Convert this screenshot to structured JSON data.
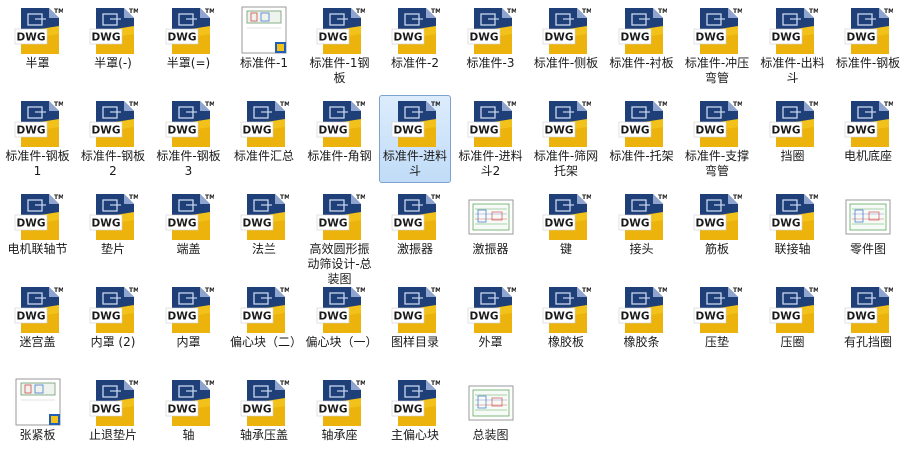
{
  "colors": {
    "selection": "#c9e0f7",
    "selection_border": "#7da2ce",
    "dwg_yellow": "#f1c40f",
    "dwg_blue": "#1f3f79"
  },
  "icons": {
    "dwg": "dwg-file-icon",
    "thumb_red": "drawing-thumbnail-icon",
    "thumb_green": "drawing-preview-icon"
  },
  "files": [
    {
      "label": "半罩",
      "icon": "dwg"
    },
    {
      "label": "半罩(-)",
      "icon": "dwg"
    },
    {
      "label": "半罩(=)",
      "icon": "dwg"
    },
    {
      "label": "标准件-1",
      "icon": "thumb_red"
    },
    {
      "label": "标准件-1钢板",
      "icon": "dwg"
    },
    {
      "label": "标准件-2",
      "icon": "dwg"
    },
    {
      "label": "标准件-3",
      "icon": "dwg"
    },
    {
      "label": "标准件-侧板",
      "icon": "dwg"
    },
    {
      "label": "标准件-衬板",
      "icon": "dwg"
    },
    {
      "label": "标准件-冲压弯管",
      "icon": "dwg"
    },
    {
      "label": "标准件-出料斗",
      "icon": "dwg"
    },
    {
      "label": "标准件-钢板",
      "icon": "dwg"
    },
    {
      "label": "标准件-钢板1",
      "icon": "dwg"
    },
    {
      "label": "标准件-钢板2",
      "icon": "dwg"
    },
    {
      "label": "标准件-钢板3",
      "icon": "dwg"
    },
    {
      "label": "标准件汇总",
      "icon": "dwg"
    },
    {
      "label": "标准件-角钢",
      "icon": "dwg"
    },
    {
      "label": "标准件-进料斗",
      "icon": "dwg",
      "selected": true
    },
    {
      "label": "标准件-进料斗2",
      "icon": "dwg"
    },
    {
      "label": "标准件-筛网托架",
      "icon": "dwg"
    },
    {
      "label": "标准件-托架",
      "icon": "dwg"
    },
    {
      "label": "标准件-支撑弯管",
      "icon": "dwg"
    },
    {
      "label": "挡圈",
      "icon": "dwg"
    },
    {
      "label": "电机底座",
      "icon": "dwg"
    },
    {
      "label": "电机联轴节",
      "icon": "dwg"
    },
    {
      "label": "垫片",
      "icon": "dwg"
    },
    {
      "label": "端盖",
      "icon": "dwg"
    },
    {
      "label": "法兰",
      "icon": "dwg"
    },
    {
      "label": "高效圆形振动筛设计-总装图",
      "icon": "dwg"
    },
    {
      "label": "激振器",
      "icon": "dwg"
    },
    {
      "label": "激振器",
      "icon": "thumb_green"
    },
    {
      "label": "键",
      "icon": "dwg"
    },
    {
      "label": "接头",
      "icon": "dwg"
    },
    {
      "label": "筋板",
      "icon": "dwg"
    },
    {
      "label": "联接轴",
      "icon": "dwg"
    },
    {
      "label": "零件图",
      "icon": "thumb_green"
    },
    {
      "label": "迷宫盖",
      "icon": "dwg"
    },
    {
      "label": "内罩 (2)",
      "icon": "dwg"
    },
    {
      "label": "内罩",
      "icon": "dwg"
    },
    {
      "label": "偏心块（二）",
      "icon": "dwg"
    },
    {
      "label": "偏心块（一）",
      "icon": "dwg"
    },
    {
      "label": "图样目录",
      "icon": "dwg"
    },
    {
      "label": "外罩",
      "icon": "dwg"
    },
    {
      "label": "橡胶板",
      "icon": "dwg"
    },
    {
      "label": "橡胶条",
      "icon": "dwg"
    },
    {
      "label": "压垫",
      "icon": "dwg"
    },
    {
      "label": "压圈",
      "icon": "dwg"
    },
    {
      "label": "有孔挡圈",
      "icon": "dwg"
    },
    {
      "label": "张紧板",
      "icon": "thumb_red"
    },
    {
      "label": "止退垫片",
      "icon": "dwg"
    },
    {
      "label": "轴",
      "icon": "dwg"
    },
    {
      "label": "轴承压盖",
      "icon": "dwg"
    },
    {
      "label": "轴承座",
      "icon": "dwg"
    },
    {
      "label": "主偏心块",
      "icon": "dwg"
    },
    {
      "label": "总装图",
      "icon": "thumb_green"
    }
  ]
}
